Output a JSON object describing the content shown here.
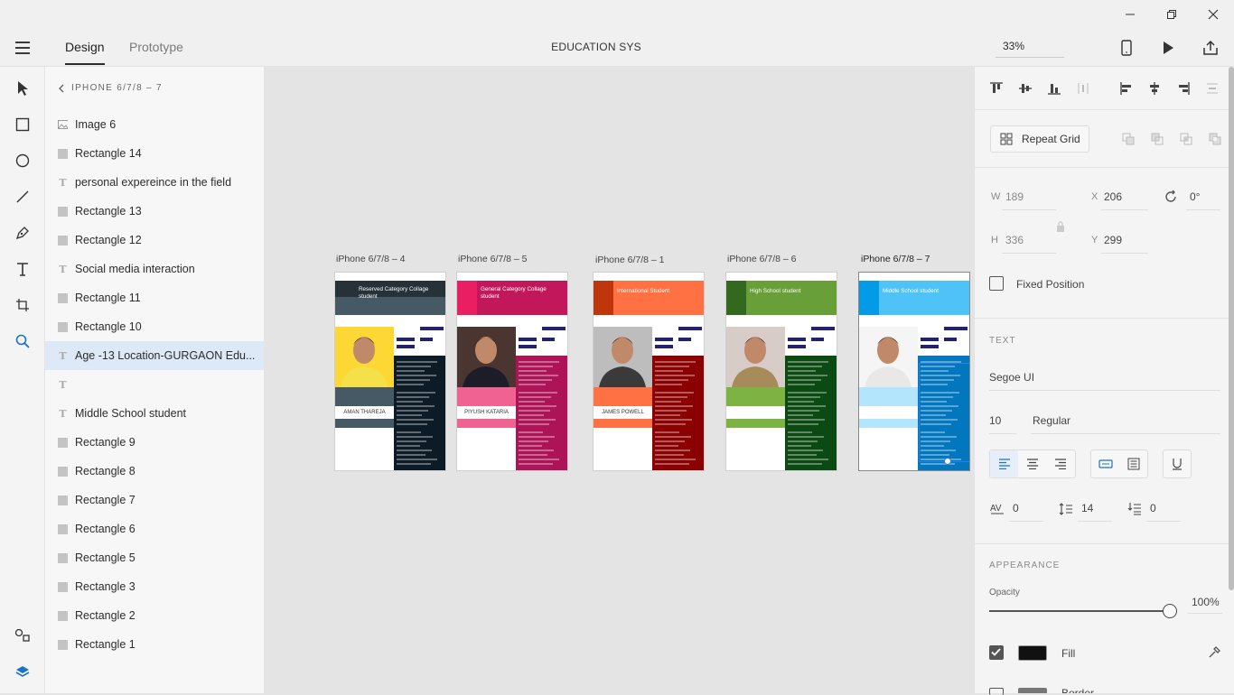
{
  "window": {
    "minimize_icon": "minimize-icon",
    "restore_icon": "restore-icon",
    "close_icon": "close-icon"
  },
  "header": {
    "tabs": [
      "Design",
      "Prototype"
    ],
    "title": "EDUCATION SYS",
    "zoom": "33%"
  },
  "layers": {
    "breadcrumb": "IPHONE 6/7/8 – 7",
    "items": [
      {
        "type": "image",
        "label": "Image 6"
      },
      {
        "type": "rect",
        "label": "Rectangle 14"
      },
      {
        "type": "text",
        "label": "personal expereince in the  field"
      },
      {
        "type": "rect",
        "label": "Rectangle 13"
      },
      {
        "type": "rect",
        "label": "Rectangle 12"
      },
      {
        "type": "text",
        "label": "Social media interaction"
      },
      {
        "type": "rect",
        "label": "Rectangle 11"
      },
      {
        "type": "rect",
        "label": "Rectangle 10"
      },
      {
        "type": "text",
        "label": "Age -13 Location-GURGAON Edu..."
      },
      {
        "type": "text",
        "label": ""
      },
      {
        "type": "text",
        "label": "Middle School student"
      },
      {
        "type": "rect",
        "label": "Rectangle 9"
      },
      {
        "type": "rect",
        "label": "Rectangle 8"
      },
      {
        "type": "rect",
        "label": "Rectangle 7"
      },
      {
        "type": "rect",
        "label": "Rectangle 6"
      },
      {
        "type": "rect",
        "label": "Rectangle 5"
      },
      {
        "type": "rect",
        "label": "Rectangle 3"
      },
      {
        "type": "rect",
        "label": "Rectangle 2"
      },
      {
        "type": "rect",
        "label": "Rectangle 1"
      }
    ],
    "selected_index": 8
  },
  "artboards": [
    {
      "label": "iPhone 6/7/8 – 4",
      "header": "Reserved  Category Collage student",
      "name": "AMAN THAREJA",
      "hdr_color": "#455a64",
      "hdr_dark": "#263238",
      "side_color": "#0d1b26",
      "band_color": "#455a64",
      "bg_color": "#fdd835"
    },
    {
      "label": "iPhone 6/7/8 – 5",
      "header": "General Category Collage student",
      "name": "PIYUSH KATARIA",
      "hdr_color": "#c2185b",
      "hdr_dark": "#e91e63",
      "side_color": "#ad1457",
      "band_color": "#f06292",
      "bg_color": "#4a3530"
    },
    {
      "label": "iPhone 6/7/8 – 1",
      "header": "International Student",
      "name": "JAMES POWELL",
      "hdr_color": "#ff7043",
      "hdr_dark": "#bf360c",
      "side_color": "#8b0000",
      "band_color": "#ff7043",
      "bg_color": "#bdbdbd"
    },
    {
      "label": "iPhone 6/7/8 – 6",
      "header": "High School student",
      "name": "",
      "hdr_color": "#689f38",
      "hdr_dark": "#33691e",
      "side_color": "#0b4a12",
      "band_color": "#7cb342",
      "bg_color": "#d7ccc8"
    },
    {
      "label": "iPhone 6/7/8 – 7",
      "header": "Middle School student",
      "name": "",
      "hdr_color": "#4fc3f7",
      "hdr_dark": "#039be5",
      "side_color": "#0277bd",
      "band_color": "#b3e5fc",
      "bg_color": "#f5f5f5"
    }
  ],
  "props": {
    "repeat_grid": "Repeat Grid",
    "w_label": "W",
    "w": "189",
    "x_label": "X",
    "x": "206",
    "rotation": "0°",
    "h_label": "H",
    "h": "336",
    "y_label": "Y",
    "y": "299",
    "fixed_position": "Fixed Position",
    "text_heading": "TEXT",
    "font": "Segoe UI",
    "font_size": "10",
    "font_weight": "Regular",
    "char_spacing": "0",
    "line_spacing": "14",
    "para_spacing": "0",
    "appearance_heading": "APPEARANCE",
    "opacity_label": "Opacity",
    "opacity": "100%",
    "opacity_fraction": 1.0,
    "fill_label": "Fill",
    "fill_color": "#111111",
    "border_label": "Border"
  }
}
